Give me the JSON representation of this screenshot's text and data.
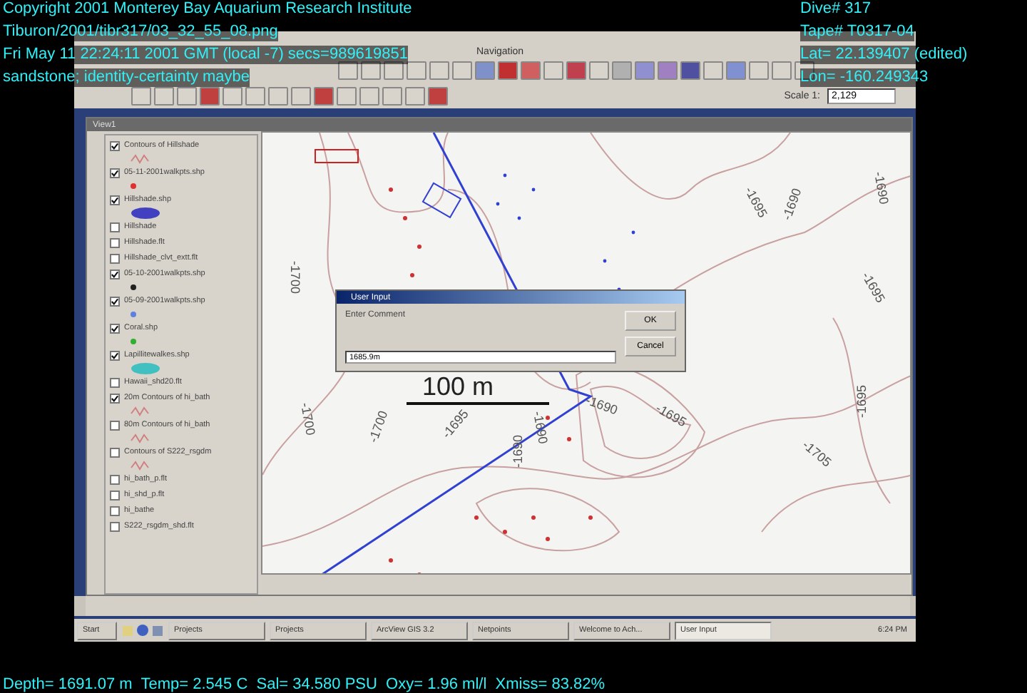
{
  "overlay": {
    "left_lines": [
      "Copyright 2001 Monterey Bay Aquarium Research Institute",
      "Tiburon/2001/tibr317/03_32_55_08.png",
      "Fri May 11 22:24:11 2001 GMT (local -7)  secs=989619851",
      "sandstone; identity-certainty maybe"
    ],
    "right_lines": [
      "Dive# 317",
      "Tape# T0317-04",
      "Lat= 22.139407 (edited)",
      "Lon= -160.249343"
    ],
    "bottom_line": "Depth= 1691.07 m  Temp= 2.545 C  Sal= 34.580 PSU  Oxy= 1.96 ml/l  Xmiss= 83.82%"
  },
  "menubar": {
    "label": "Navigation"
  },
  "scale": {
    "label": "Scale 1:",
    "value": "2,129"
  },
  "view": {
    "title": "View1"
  },
  "legend": [
    {
      "name": "Contours of Hillshade",
      "checked": true,
      "symbol": {
        "kind": "line",
        "color": "#d08080"
      }
    },
    {
      "name": "05-11-2001walkpts.shp",
      "checked": true,
      "symbol": {
        "kind": "point",
        "color": "#e03030"
      }
    },
    {
      "name": "Hillshade.shp",
      "checked": true,
      "symbol": {
        "kind": "polygon",
        "color": "#4040c0"
      }
    },
    {
      "name": "Hillshade",
      "checked": false
    },
    {
      "name": "Hillshade.flt",
      "checked": false
    },
    {
      "name": "Hillshade_clvt_extt.flt",
      "checked": false
    },
    {
      "name": "05-10-2001walkpts.shp",
      "checked": true,
      "symbol": {
        "kind": "point",
        "color": "#202020"
      }
    },
    {
      "name": "05-09-2001walkpts.shp",
      "checked": true,
      "symbol": {
        "kind": "point",
        "color": "#6080e0"
      }
    },
    {
      "name": "Coral.shp",
      "checked": true,
      "symbol": {
        "kind": "point",
        "color": "#30b030"
      }
    },
    {
      "name": "Lapillitewalkes.shp",
      "checked": true,
      "symbol": {
        "kind": "polygon",
        "color": "#40c0c0"
      }
    },
    {
      "name": "Hawaii_shd20.flt",
      "checked": false
    },
    {
      "name": "20m Contours of hi_bath",
      "checked": true,
      "symbol": {
        "kind": "line",
        "color": "#d08080"
      }
    },
    {
      "name": "80m Contours of hi_bath",
      "checked": false,
      "symbol": {
        "kind": "line",
        "color": "#d08080"
      }
    },
    {
      "name": "Contours of S222_rsgdm",
      "checked": false,
      "symbol": {
        "kind": "line",
        "color": "#d08080"
      }
    },
    {
      "name": "hi_bath_p.flt",
      "checked": false
    },
    {
      "name": "hi_shd_p.flt",
      "checked": false
    },
    {
      "name": "hi_bathe",
      "checked": false
    },
    {
      "name": "S222_rsgdm_shd.flt",
      "checked": false
    }
  ],
  "map": {
    "scale_bar": "100 m",
    "labels": [
      "-1695",
      "-1690",
      "-1700",
      "-1700",
      "-1690",
      "-1695",
      "-1690",
      "-1700",
      "-1695",
      "-1690",
      "-1705",
      "-1695",
      "-1695",
      "-1690"
    ]
  },
  "dialog": {
    "title": "User Input",
    "prompt": "Enter Comment",
    "value": "1685.9m",
    "buttons": [
      "OK",
      "Cancel"
    ]
  },
  "taskbar": {
    "start": "Start",
    "tasks": [
      {
        "label": "Projects",
        "selected": false
      },
      {
        "label": "Projects",
        "selected": false
      },
      {
        "label": "ArcView GIS 3.2",
        "selected": false
      },
      {
        "label": "Netpoints",
        "selected": false
      },
      {
        "label": "Welcome to Ach...",
        "selected": false
      },
      {
        "label": "User Input",
        "selected": true
      }
    ],
    "clock": "6:24 PM"
  }
}
